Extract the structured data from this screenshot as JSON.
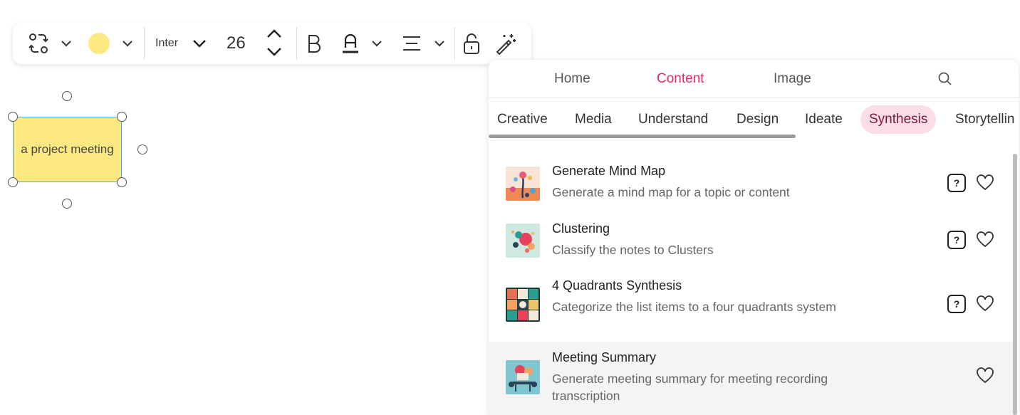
{
  "toolbar": {
    "font_family": "Inter",
    "font_size": "26",
    "fill_color": "#fde981",
    "icons": [
      "shape-swap-icon",
      "chevron-down-icon",
      "color-swatch",
      "chevron-down-icon",
      "chevron-down-icon",
      "chevron-up-icon",
      "chevron-down-icon",
      "bold-icon",
      "text-color-icon",
      "chevron-down-icon",
      "align-icon",
      "chevron-down-icon",
      "unlock-icon",
      "magic-wand-icon"
    ]
  },
  "canvas": {
    "sticky_text": "a project meeting",
    "sticky_color": "#fde981",
    "selection_color": "#4fa6d8"
  },
  "panel": {
    "tabs": [
      {
        "label": "Home"
      },
      {
        "label": "Content"
      },
      {
        "label": "Image"
      }
    ],
    "active_tab": "Content",
    "accent_color": "#e5266f",
    "categories": [
      {
        "label": "Creative"
      },
      {
        "label": "Media"
      },
      {
        "label": "Understand"
      },
      {
        "label": "Design"
      },
      {
        "label": "Ideate"
      },
      {
        "label": "Synthesis"
      },
      {
        "label": "Storytellin"
      }
    ],
    "active_category": "Synthesis",
    "items": [
      {
        "title": "Generate Mind Map",
        "desc": "Generate a mind map for a topic or content"
      },
      {
        "title": "Clustering",
        "desc": "Classify the notes to Clusters"
      },
      {
        "title": "4 Quadrants Synthesis",
        "desc": "Categorize the list items to a four quadrants system"
      },
      {
        "title": "Meeting Summary",
        "desc": "Generate meeting summary for meeting recording transcription"
      }
    ],
    "help_label": "?"
  }
}
